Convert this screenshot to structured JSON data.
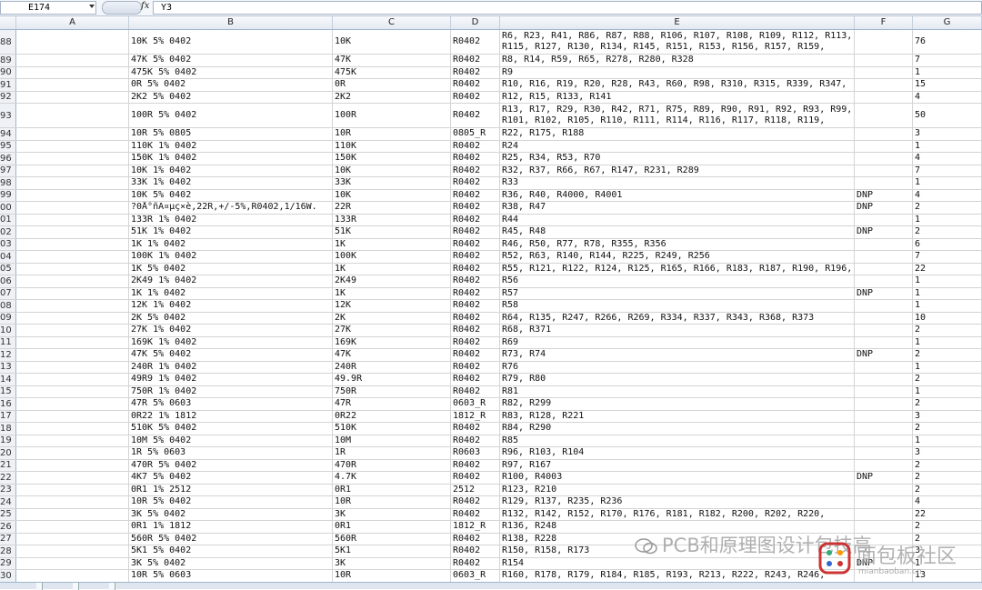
{
  "formula_bar": {
    "name_box": "E174",
    "formula": "Y3"
  },
  "columns": [
    "A",
    "B",
    "C",
    "D",
    "E",
    "F",
    "G"
  ],
  "rows": [
    {
      "n": "88",
      "b": "10K 5% 0402",
      "c": "10K",
      "d": "R0402",
      "e": "R6, R23, R41, R86, R87, R88, R106, R107, R108, R109, R112, R113,\nR115, R127, R130, R134, R145, R151, R153, R156, R157, R159,",
      "f": "",
      "g": "76"
    },
    {
      "n": "89",
      "b": "47K 5% 0402",
      "c": "47K",
      "d": "R0402",
      "e": "R8, R14, R59, R65, R278, R280, R328",
      "f": "",
      "g": "7"
    },
    {
      "n": "90",
      "b": "475K 5% 0402",
      "c": "475K",
      "d": "R0402",
      "e": "R9",
      "f": "",
      "g": "1"
    },
    {
      "n": "91",
      "b": "0R 5% 0402",
      "c": "0R",
      "d": "R0402",
      "e": "R10, R16, R19, R20, R28, R43, R60, R98, R310, R315, R339, R347,",
      "f": "",
      "g": "15"
    },
    {
      "n": "92",
      "b": "2K2 5% 0402",
      "c": "2K2",
      "d": "R0402",
      "e": "R12, R15, R133, R141",
      "f": "",
      "g": "4"
    },
    {
      "n": "93",
      "b": "100R 5% 0402",
      "c": "100R",
      "d": "R0402",
      "e": "R13, R17, R29, R30, R42, R71, R75, R89, R90, R91, R92, R93, R99,\nR101, R102, R105, R110, R111, R114, R116, R117, R118, R119,",
      "f": "",
      "g": "50"
    },
    {
      "n": "94",
      "b": "10R 5% 0805",
      "c": "10R",
      "d": "0805_R",
      "e": "R22, R175, R188",
      "f": "",
      "g": "3"
    },
    {
      "n": "95",
      "b": "110K 1% 0402",
      "c": "110K",
      "d": "R0402",
      "e": "R24",
      "f": "",
      "g": "1"
    },
    {
      "n": "96",
      "b": "150K 1% 0402",
      "c": "150K",
      "d": "R0402",
      "e": "R25, R34, R53, R70",
      "f": "",
      "g": "4"
    },
    {
      "n": "97",
      "b": "10K 1% 0402",
      "c": "10K",
      "d": "R0402",
      "e": "R32, R37, R66, R67, R147, R231, R289",
      "f": "",
      "g": "7"
    },
    {
      "n": "98",
      "b": "33K 1% 0402",
      "c": "33K",
      "d": "R0402",
      "e": "R33",
      "f": "",
      "g": "1"
    },
    {
      "n": "99",
      "b": "10K 5% 0402",
      "c": "10K",
      "d": "R0402",
      "e": "R36, R40, R4000, R4001",
      "f": "DNP",
      "g": "4"
    },
    {
      "n": "00",
      "b": "?0Å°ñÃ¤µç×è,22R,+/-5%,R0402,1/16W.",
      "c": "22R",
      "d": "R0402",
      "e": "R38, R47",
      "f": "DNP",
      "g": "2"
    },
    {
      "n": "01",
      "b": "133R 1% 0402",
      "c": "133R",
      "d": "R0402",
      "e": "R44",
      "f": "",
      "g": "1"
    },
    {
      "n": "02",
      "b": "51K 1% 0402",
      "c": "51K",
      "d": "R0402",
      "e": "R45, R48",
      "f": "DNP",
      "g": "2"
    },
    {
      "n": "03",
      "b": "1K 1% 0402",
      "c": "1K",
      "d": "R0402",
      "e": "R46, R50, R77, R78, R355, R356",
      "f": "",
      "g": "6"
    },
    {
      "n": "04",
      "b": "100K 1% 0402",
      "c": "100K",
      "d": "R0402",
      "e": "R52, R63, R140, R144, R225, R249, R256",
      "f": "",
      "g": "7"
    },
    {
      "n": "05",
      "b": "1K 5% 0402",
      "c": "1K",
      "d": "R0402",
      "e": "R55, R121, R122, R124, R125, R165, R166, R183, R187, R190, R196,",
      "f": "",
      "g": "22"
    },
    {
      "n": "06",
      "b": "2K49 1% 0402",
      "c": "2K49",
      "d": "R0402",
      "e": "R56",
      "f": "",
      "g": "1"
    },
    {
      "n": "07",
      "b": "1K 1% 0402",
      "c": "1K",
      "d": "R0402",
      "e": "R57",
      "f": "DNP",
      "g": "1"
    },
    {
      "n": "08",
      "b": "12K 1% 0402",
      "c": "12K",
      "d": "R0402",
      "e": "R58",
      "f": "",
      "g": "1"
    },
    {
      "n": "09",
      "b": "2K 5% 0402",
      "c": "2K",
      "d": "R0402",
      "e": "R64, R135, R247, R266, R269, R334, R337, R343, R368, R373",
      "f": "",
      "g": "10"
    },
    {
      "n": "10",
      "b": "27K 1% 0402",
      "c": "27K",
      "d": "R0402",
      "e": "R68, R371",
      "f": "",
      "g": "2"
    },
    {
      "n": "11",
      "b": "169K 1% 0402",
      "c": "169K",
      "d": "R0402",
      "e": "R69",
      "f": "",
      "g": "1"
    },
    {
      "n": "12",
      "b": "47K 5% 0402",
      "c": "47K",
      "d": "R0402",
      "e": "R73, R74",
      "f": "DNP",
      "g": "2"
    },
    {
      "n": "13",
      "b": "240R 1% 0402",
      "c": "240R",
      "d": "R0402",
      "e": "R76",
      "f": "",
      "g": "1"
    },
    {
      "n": "14",
      "b": "49R9 1% 0402",
      "c": "49.9R",
      "d": "R0402",
      "e": "R79, R80",
      "f": "",
      "g": "2"
    },
    {
      "n": "15",
      "b": "750R  1% 0402",
      "c": "750R",
      "d": "R0402",
      "e": "R81",
      "f": "",
      "g": "1"
    },
    {
      "n": "16",
      "b": "47R 5% 0603",
      "c": "47R",
      "d": "0603_R",
      "e": "R82, R299",
      "f": "",
      "g": "2"
    },
    {
      "n": "17",
      "b": "0R22 1% 1812",
      "c": "0R22",
      "d": "1812_R",
      "e": "R83, R128, R221",
      "f": "",
      "g": "3"
    },
    {
      "n": "18",
      "b": "510K 5% 0402",
      "c": "510K",
      "d": "R0402",
      "e": "R84, R290",
      "f": "",
      "g": "2"
    },
    {
      "n": "19",
      "b": "10M 5% 0402",
      "c": "10M",
      "d": "R0402",
      "e": "R85",
      "f": "",
      "g": "1"
    },
    {
      "n": "20",
      "b": "1R 5% 0603",
      "c": "1R",
      "d": "R0603",
      "e": "R96, R103, R104",
      "f": "",
      "g": "3"
    },
    {
      "n": "21",
      "b": "470R 5% 0402",
      "c": "470R",
      "d": "R0402",
      "e": "R97, R167",
      "f": "",
      "g": "2"
    },
    {
      "n": "22",
      "b": "4K7 5% 0402",
      "c": "4.7K",
      "d": "R0402",
      "e": "R100, R4003",
      "f": "DNP",
      "g": "2"
    },
    {
      "n": "23",
      "b": "0R1 1% 2512",
      "c": "0R1",
      "d": "2512",
      "e": "R123, R210",
      "f": "",
      "g": "2"
    },
    {
      "n": "24",
      "b": "10R 5% 0402",
      "c": "10R",
      "d": "R0402",
      "e": "R129, R137, R235, R236",
      "f": "",
      "g": "4"
    },
    {
      "n": "25",
      "b": "3K 5% 0402",
      "c": "3K",
      "d": "R0402",
      "e": "R132, R142, R152, R170, R176, R181, R182, R200, R202, R220,",
      "f": "",
      "g": "22"
    },
    {
      "n": "26",
      "b": "0R1 1% 1812",
      "c": "0R1",
      "d": "1812_R",
      "e": "R136, R248",
      "f": "",
      "g": "2"
    },
    {
      "n": "27",
      "b": "560R 5% 0402",
      "c": "560R",
      "d": "R0402",
      "e": "R138, R228",
      "f": "",
      "g": "2"
    },
    {
      "n": "28",
      "b": "5K1 5% 0402",
      "c": "5K1",
      "d": "R0402",
      "e": "R150, R158, R173",
      "f": "",
      "g": "3"
    },
    {
      "n": "29",
      "b": "3K 5% 0402",
      "c": "3K",
      "d": "R0402",
      "e": "R154",
      "f": "DNP",
      "g": "1"
    },
    {
      "n": "30",
      "b": "10R 5% 0603",
      "c": "10R",
      "d": "0603_R",
      "e": "R160, R178, R179, R184, R185, R193, R213, R222, R243, R246,",
      "f": "",
      "g": "13"
    }
  ],
  "watermark": {
    "text": "PCB和原理图设计包技高",
    "logo_text": "面包板社区",
    "logo_sub": "mianbaoban.cn"
  }
}
